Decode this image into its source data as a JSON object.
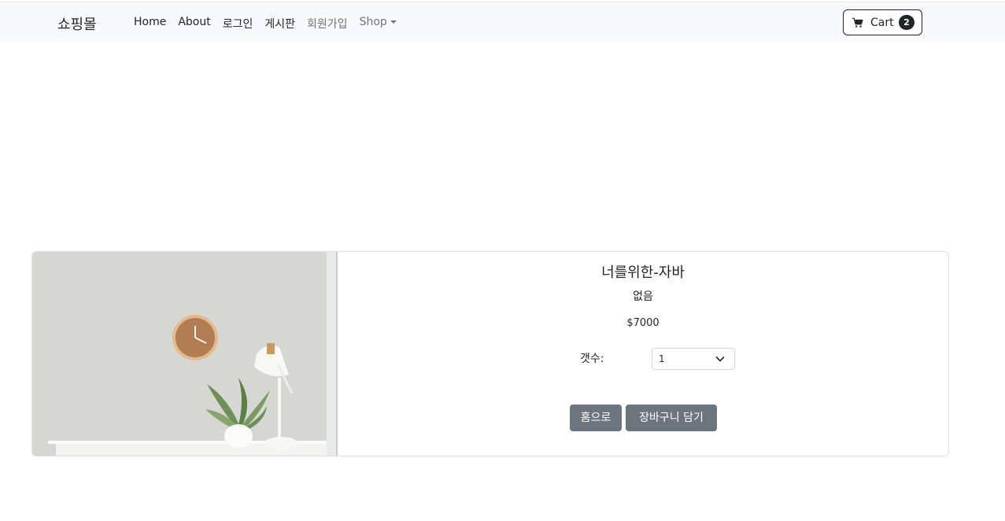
{
  "navbar": {
    "brand": "쇼핑몰",
    "links": [
      {
        "label": "Home"
      },
      {
        "label": "About"
      },
      {
        "label": "로그인"
      },
      {
        "label": "게시판"
      },
      {
        "label": "회원가입"
      },
      {
        "label": "Shop"
      }
    ],
    "cart": {
      "label": "Cart",
      "count": "2",
      "icon": "cart-icon"
    }
  },
  "product": {
    "name": "너를위한-자바",
    "description": "없음",
    "price": "$7000",
    "quantity_label": "갯수:",
    "quantity_value": "1",
    "image": "product-photo (wall clock, desk lamp, potted plant)"
  },
  "actions": {
    "home_label": "홈으로",
    "add_to_cart_label": "장바구니 담기"
  },
  "colors": {
    "navbar_bg": "#f8f9fa",
    "button_bg": "#6c757d",
    "badge_bg": "#212529"
  }
}
